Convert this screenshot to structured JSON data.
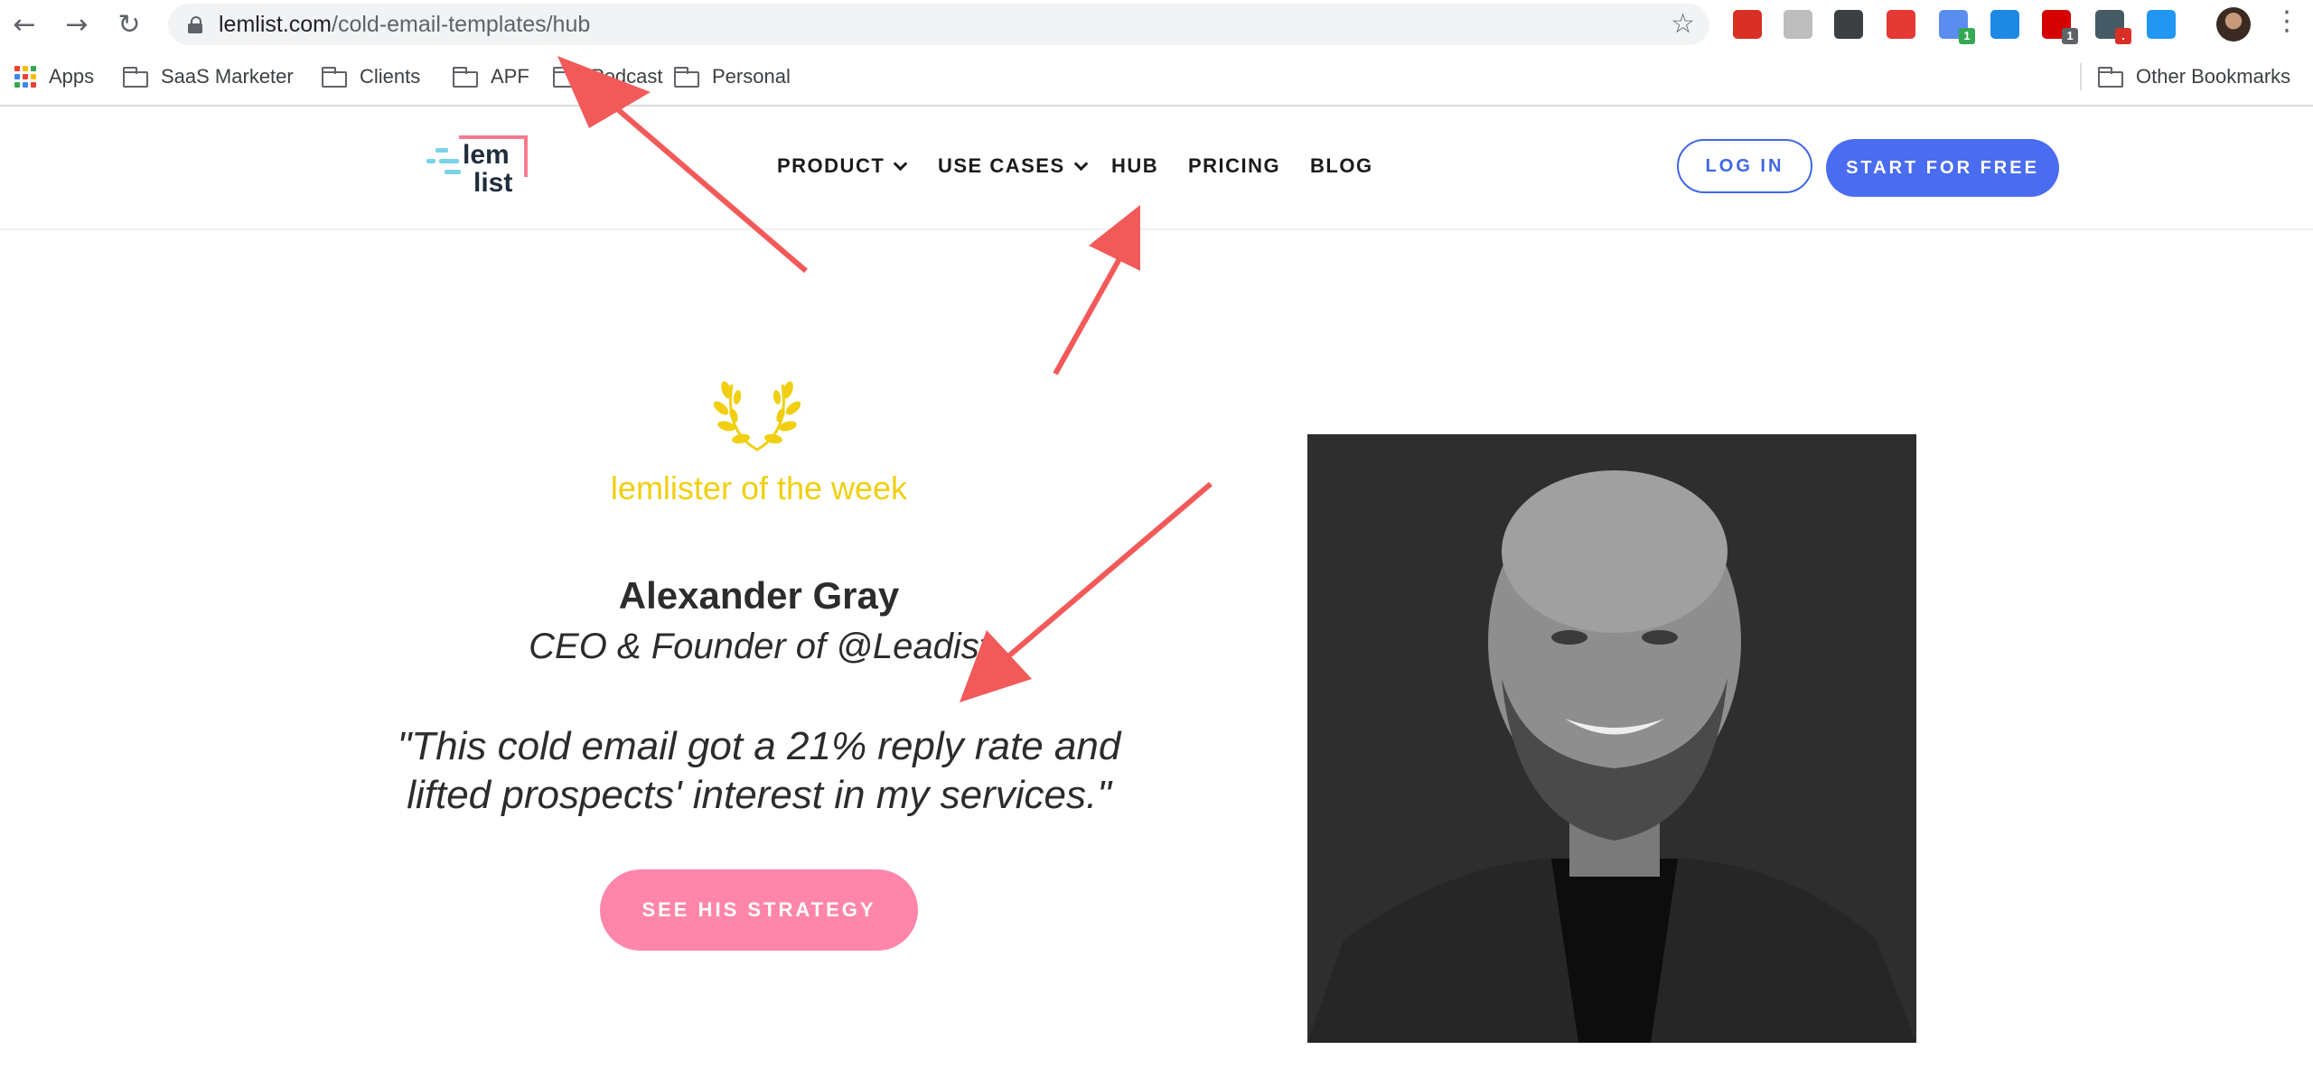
{
  "browser": {
    "url_domain": "lemlist.com",
    "url_path": "/cold-email-templates/hub",
    "extensions": [
      {
        "name": "extension-red-icon",
        "color": "#d93025",
        "badge": ""
      },
      {
        "name": "extension-clipboard-icon",
        "color": "#bdbdbd",
        "badge": ""
      },
      {
        "name": "extension-m-icon",
        "color": "#3c4043",
        "badge": ""
      },
      {
        "name": "extension-cart-icon",
        "color": "#e53935",
        "badge": ""
      },
      {
        "name": "extension-code-icon",
        "color": "#5b8def",
        "badge": "1"
      },
      {
        "name": "extension-blue-icon",
        "color": "#1e88e5",
        "badge": ""
      },
      {
        "name": "extension-opera-icon",
        "color": "#d50000",
        "badge": "1"
      },
      {
        "name": "extension-eyedropper-icon",
        "color": "#455a64",
        "badge": "."
      },
      {
        "name": "extension-drop-icon",
        "color": "#2196f3",
        "badge": ""
      }
    ]
  },
  "bookmarks": {
    "apps": "Apps",
    "items": [
      "SaaS Marketer",
      "Clients",
      "APF",
      "Podcast",
      "Personal"
    ],
    "other": "Other Bookmarks"
  },
  "site": {
    "logo_line1": "lem",
    "logo_line2": "list",
    "nav": {
      "product": "PRODUCT",
      "use_cases": "USE CASES",
      "hub": "HUB",
      "pricing": "PRICING",
      "blog": "BLOG"
    },
    "login": "LOG IN",
    "start": "START FOR FREE"
  },
  "hero": {
    "badge_title": "lemlister of the week",
    "name": "Alexander Gray",
    "role": "CEO & Founder of @Leadist",
    "quote_line1": "\"This cold email got a 21% reply rate and",
    "quote_line2": "lifted prospects' interest in my services.\"",
    "cta": "SEE HIS STRATEGY"
  },
  "colors": {
    "accent_blue": "#4a6cf0",
    "gold": "#f1cf10",
    "pink": "#ff86aa",
    "annotation_red": "#f25a5a"
  }
}
